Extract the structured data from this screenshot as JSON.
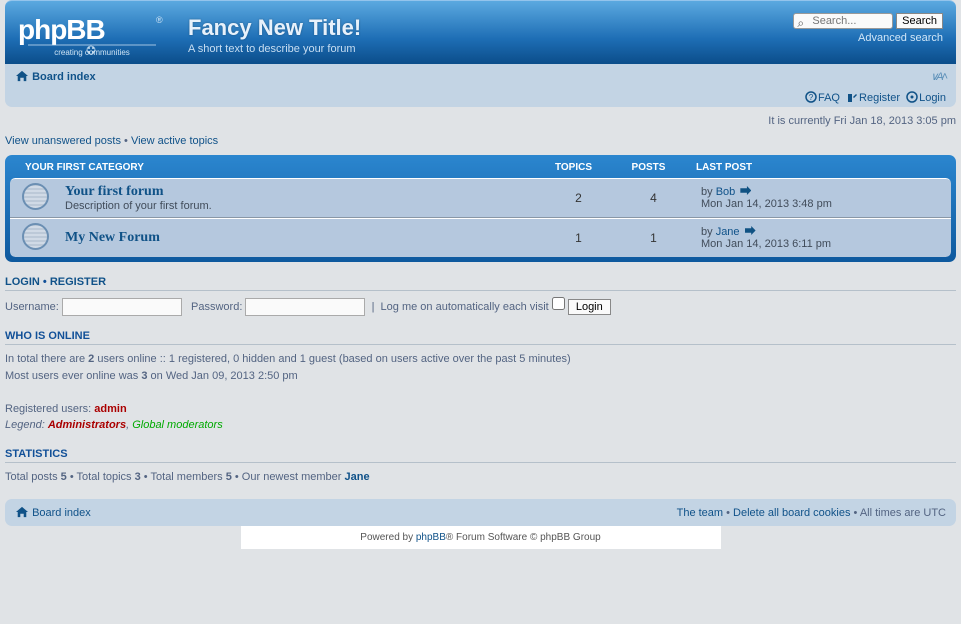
{
  "header": {
    "title": "Fancy New Title!",
    "subtitle": "A short text to describe your forum"
  },
  "search": {
    "placeholder": "Search...",
    "button": "Search",
    "advanced": "Advanced search"
  },
  "nav": {
    "board_index": "Board index",
    "faq": "FAQ",
    "register": "Register",
    "login": "Login",
    "font_toggle": "∨A˄"
  },
  "time": "It is currently Fri Jan 18, 2013 3:05 pm",
  "quicklinks": {
    "unanswered": "View unanswered posts",
    "active": "View active topics",
    "sep": " • "
  },
  "category": {
    "name": "YOUR FIRST CATEGORY",
    "cols": {
      "topics": "TOPICS",
      "posts": "POSTS",
      "last": "LAST POST"
    },
    "forums": [
      {
        "title": "Your first forum",
        "desc": "Description of your first forum.",
        "topics": "2",
        "posts": "4",
        "last_by_prefix": "by ",
        "last_by_user": "Bob",
        "last_time": "Mon Jan 14, 2013 3:48 pm"
      },
      {
        "title": "My New Forum",
        "desc": "",
        "topics": "1",
        "posts": "1",
        "last_by_prefix": "by ",
        "last_by_user": "Jane",
        "last_time": "Mon Jan 14, 2013 6:11 pm"
      }
    ]
  },
  "login_section": {
    "heading_login": "LOGIN",
    "heading_sep": "  •  ",
    "heading_register": "REGISTER",
    "username_label": "Username:",
    "password_label": "Password:",
    "autologin": "Log me on automatically each visit",
    "button": "Login"
  },
  "online": {
    "heading": "WHO IS ONLINE",
    "line1a": "In total there are ",
    "line1_count": "2",
    "line1b": " users online :: 1 registered, 0 hidden and 1 guest (based on users active over the past 5 minutes)",
    "line2a": "Most users ever online was ",
    "line2_count": "3",
    "line2b": " on Wed Jan 09, 2013 2:50 pm",
    "reg_label": "Registered users: ",
    "reg_user": "admin",
    "legend_label": "Legend: ",
    "legend_admin": "Administrators",
    "legend_sep": ", ",
    "legend_global": "Global moderators"
  },
  "stats": {
    "heading": "STATISTICS",
    "a1": "Total posts ",
    "v1": "5",
    "a2": " • Total topics ",
    "v2": "3",
    "a3": " • Total members ",
    "v3": "5",
    "a4": " • Our newest member ",
    "v4": "Jane"
  },
  "footer": {
    "board_index": "Board index",
    "team": "The team",
    "cookies": "Delete all board cookies",
    "tz": "All times are UTC",
    "sep": " • "
  },
  "copyright": {
    "a": "Powered by ",
    "link": "phpBB",
    "b": "® Forum Software © phpBB Group"
  }
}
